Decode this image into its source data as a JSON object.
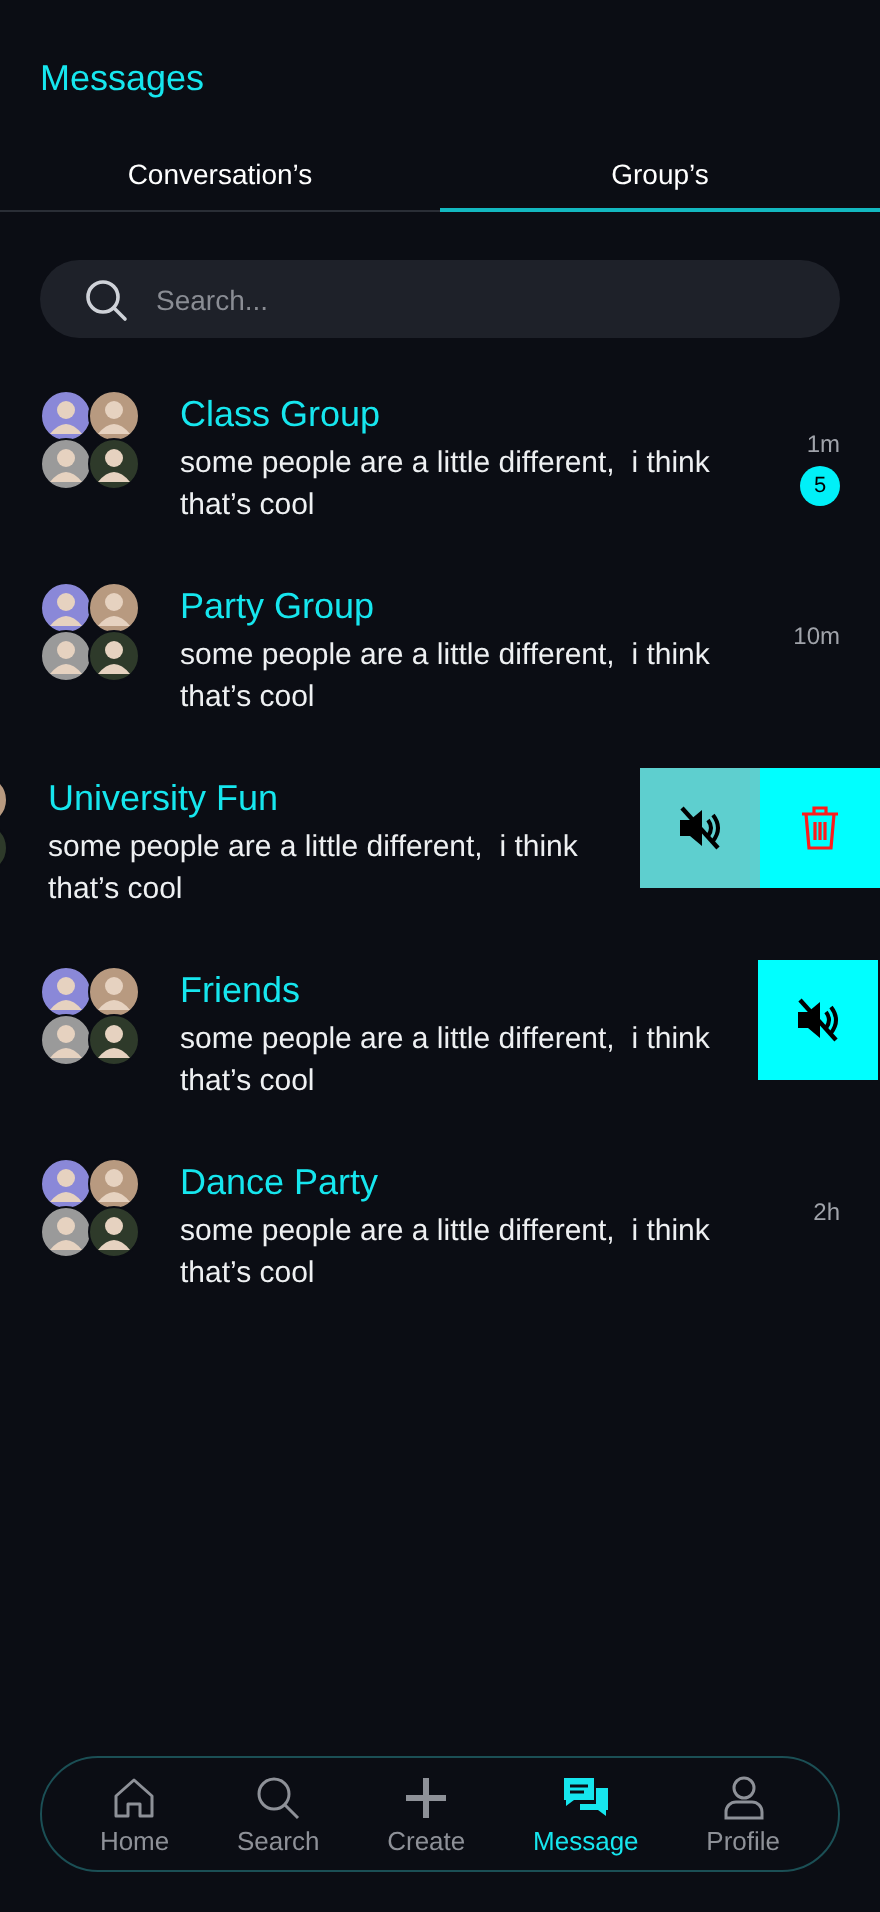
{
  "header": {
    "title": "Messages"
  },
  "tabs": [
    {
      "label": "Conversation’s",
      "selected": false
    },
    {
      "label": "Group’s",
      "selected": true
    }
  ],
  "search": {
    "placeholder": "Search..."
  },
  "chats": [
    {
      "name": "Class Group",
      "message": "some people are a little different,  i think that’s cool",
      "time": "1m",
      "unread": "5",
      "swiped": false,
      "mute_button": false,
      "delete_button": false
    },
    {
      "name": "Party Group",
      "message": "some people are a little different,  i think that’s cool",
      "time": "10m",
      "swiped": false,
      "mute_button": false,
      "delete_button": false
    },
    {
      "name": "University Fun",
      "message": "some people are a little different,  i think that’s cool",
      "swiped": true,
      "mute_button": true,
      "delete_button": true
    },
    {
      "name": "Friends",
      "message": "some people are a little different,  i think that’s cool",
      "swiped": false,
      "mute_button": true,
      "delete_button": false
    },
    {
      "name": "Dance Party",
      "message": "some people are a little different,  i think that’s cool",
      "time": "2h",
      "swiped": false,
      "mute_button": false,
      "delete_button": false
    }
  ],
  "nav": [
    {
      "label": "Home",
      "kind": "home",
      "selected": false
    },
    {
      "label": "Search",
      "kind": "search",
      "selected": false
    },
    {
      "label": "Create",
      "kind": "create",
      "selected": false
    },
    {
      "label": "Message",
      "kind": "message",
      "selected": true
    },
    {
      "label": "Profile",
      "kind": "profile",
      "selected": false
    }
  ]
}
